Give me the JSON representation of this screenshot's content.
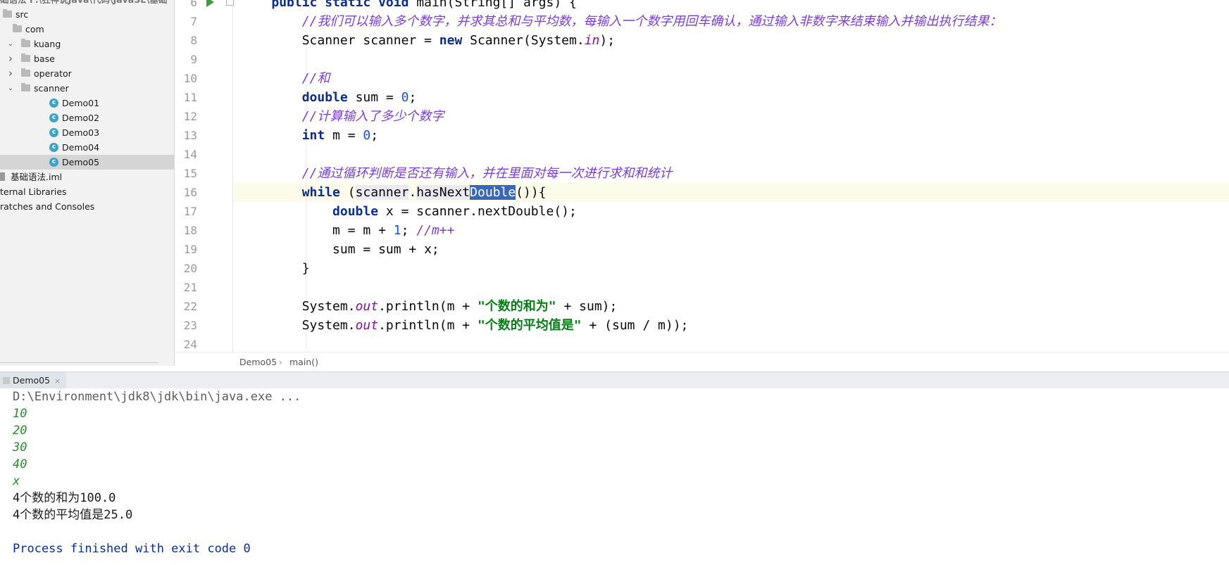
{
  "project_tree": {
    "top_cut_text": "础语法  F:\\狂神说Java\\代码\\JavaSE\\基础",
    "items": [
      {
        "label": "src",
        "indent": 0,
        "icon": "folder-icon",
        "chevron": "",
        "selected": false
      },
      {
        "label": "com",
        "indent": 1,
        "icon": "folder-icon",
        "chevron": "",
        "selected": false
      },
      {
        "label": "kuang",
        "indent": 1,
        "icon": "folder-icon",
        "chevron": "down",
        "selected": false
      },
      {
        "label": "base",
        "indent": 2,
        "icon": "folder-icon",
        "chevron": "right",
        "selected": false
      },
      {
        "label": "operator",
        "indent": 2,
        "icon": "folder-icon",
        "chevron": "right",
        "selected": false
      },
      {
        "label": "scanner",
        "indent": 2,
        "icon": "folder-icon",
        "chevron": "down",
        "selected": false
      },
      {
        "label": "Demo01",
        "indent": 3,
        "icon": "java-class-icon",
        "chevron": "",
        "selected": false
      },
      {
        "label": "Demo02",
        "indent": 3,
        "icon": "java-class-icon",
        "chevron": "",
        "selected": false
      },
      {
        "label": "Demo03",
        "indent": 3,
        "icon": "java-class-icon",
        "chevron": "",
        "selected": false
      },
      {
        "label": "Demo04",
        "indent": 3,
        "icon": "java-class-icon",
        "chevron": "",
        "selected": false
      },
      {
        "label": "Demo05",
        "indent": 3,
        "icon": "java-class-icon",
        "chevron": "",
        "selected": true
      },
      {
        "label": "基础语法.iml",
        "indent": 0,
        "icon": "module-file-icon",
        "chevron": "",
        "selected": false
      },
      {
        "label": "ternal Libraries",
        "indent": 0,
        "icon": "",
        "chevron": "",
        "selected": false
      },
      {
        "label": "ratches and Consoles",
        "indent": 0,
        "icon": "",
        "chevron": "",
        "selected": false
      }
    ]
  },
  "editor": {
    "line_numbers": [
      "6",
      "7",
      "8",
      "9",
      "10",
      "11",
      "12",
      "13",
      "14",
      "15",
      "16",
      "17",
      "18",
      "19",
      "20",
      "21",
      "22",
      "23",
      "24"
    ],
    "current_line": "16",
    "lines": [
      [
        {
          "t": "    ",
          "c": ""
        },
        {
          "t": "public static void ",
          "c": "kw"
        },
        {
          "t": "main(String[] args) {",
          "c": ""
        }
      ],
      [
        {
          "t": "        ",
          "c": ""
        },
        {
          "t": "//我们可以输入多个数字，并求其总和与平均数，每输入一个数字用回车确认，通过输入非数字来结束输入并输出执行结果：",
          "c": "cmt"
        }
      ],
      [
        {
          "t": "        Scanner scanner = ",
          "c": ""
        },
        {
          "t": "new ",
          "c": "kw"
        },
        {
          "t": "Scanner(System.",
          "c": ""
        },
        {
          "t": "in",
          "c": "fld"
        },
        {
          "t": ");",
          "c": ""
        }
      ],
      [
        {
          "t": "",
          "c": ""
        }
      ],
      [
        {
          "t": "        ",
          "c": ""
        },
        {
          "t": "//和",
          "c": "cmt"
        }
      ],
      [
        {
          "t": "        ",
          "c": ""
        },
        {
          "t": "double ",
          "c": "kw"
        },
        {
          "t": "sum = ",
          "c": ""
        },
        {
          "t": "0",
          "c": "num"
        },
        {
          "t": ";",
          "c": ""
        }
      ],
      [
        {
          "t": "        ",
          "c": ""
        },
        {
          "t": "//计算输入了多少个数字",
          "c": "cmt"
        }
      ],
      [
        {
          "t": "        ",
          "c": ""
        },
        {
          "t": "int ",
          "c": "kw"
        },
        {
          "t": "m = ",
          "c": ""
        },
        {
          "t": "0",
          "c": "num"
        },
        {
          "t": ";",
          "c": ""
        }
      ],
      [
        {
          "t": "",
          "c": ""
        }
      ],
      [
        {
          "t": "        ",
          "c": ""
        },
        {
          "t": "//通过循环判断是否还有输入，并在里面对每一次进行求和和统计",
          "c": "cmt"
        }
      ],
      [
        {
          "t": "        ",
          "c": ""
        },
        {
          "t": "while ",
          "c": "kw"
        },
        {
          "t": "(",
          "c": ""
        },
        {
          "t": "scanner",
          "c": "ref"
        },
        {
          "t": ".",
          "c": ""
        },
        {
          "t": "hasNext",
          "c": "ref"
        },
        {
          "t": "Double",
          "c": "hl"
        },
        {
          "t": "()){",
          "c": ""
        }
      ],
      [
        {
          "t": "            ",
          "c": ""
        },
        {
          "t": "double ",
          "c": "kw"
        },
        {
          "t": "x = scanner.nextDouble();",
          "c": ""
        }
      ],
      [
        {
          "t": "            m = m + ",
          "c": ""
        },
        {
          "t": "1",
          "c": "num"
        },
        {
          "t": "; ",
          "c": ""
        },
        {
          "t": "//m++",
          "c": "cmt"
        }
      ],
      [
        {
          "t": "            sum = sum + x;",
          "c": ""
        }
      ],
      [
        {
          "t": "        }",
          "c": ""
        }
      ],
      [
        {
          "t": "",
          "c": ""
        }
      ],
      [
        {
          "t": "        System.",
          "c": ""
        },
        {
          "t": "out",
          "c": "fld"
        },
        {
          "t": ".println(m + ",
          "c": ""
        },
        {
          "t": "\"个数的和为\"",
          "c": "str"
        },
        {
          "t": " + sum);",
          "c": ""
        }
      ],
      [
        {
          "t": "        System.",
          "c": ""
        },
        {
          "t": "out",
          "c": "fld"
        },
        {
          "t": ".println(m + ",
          "c": ""
        },
        {
          "t": "\"个数的平均值是\"",
          "c": "str"
        },
        {
          "t": " + (sum / m));",
          "c": ""
        }
      ],
      [
        {
          "t": "",
          "c": ""
        }
      ]
    ]
  },
  "breadcrumb": {
    "items": [
      "Demo05",
      "main()"
    ],
    "separator": "›"
  },
  "run_window": {
    "tab_label": "Demo05",
    "tab_close": "×",
    "console_lines": [
      {
        "text": "D:\\Environment\\jdk8\\jdk\\bin\\java.exe ...",
        "kind": "cmd"
      },
      {
        "text": "10",
        "kind": "input"
      },
      {
        "text": "20",
        "kind": "input"
      },
      {
        "text": "30",
        "kind": "input"
      },
      {
        "text": "40",
        "kind": "input"
      },
      {
        "text": "x",
        "kind": "input"
      },
      {
        "text": "4个数的和为100.0",
        "kind": "normal"
      },
      {
        "text": "4个数的平均值是25.0",
        "kind": "normal"
      },
      {
        "text": "",
        "kind": "normal"
      },
      {
        "text": "Process finished with exit code 0",
        "kind": "exit"
      }
    ]
  }
}
